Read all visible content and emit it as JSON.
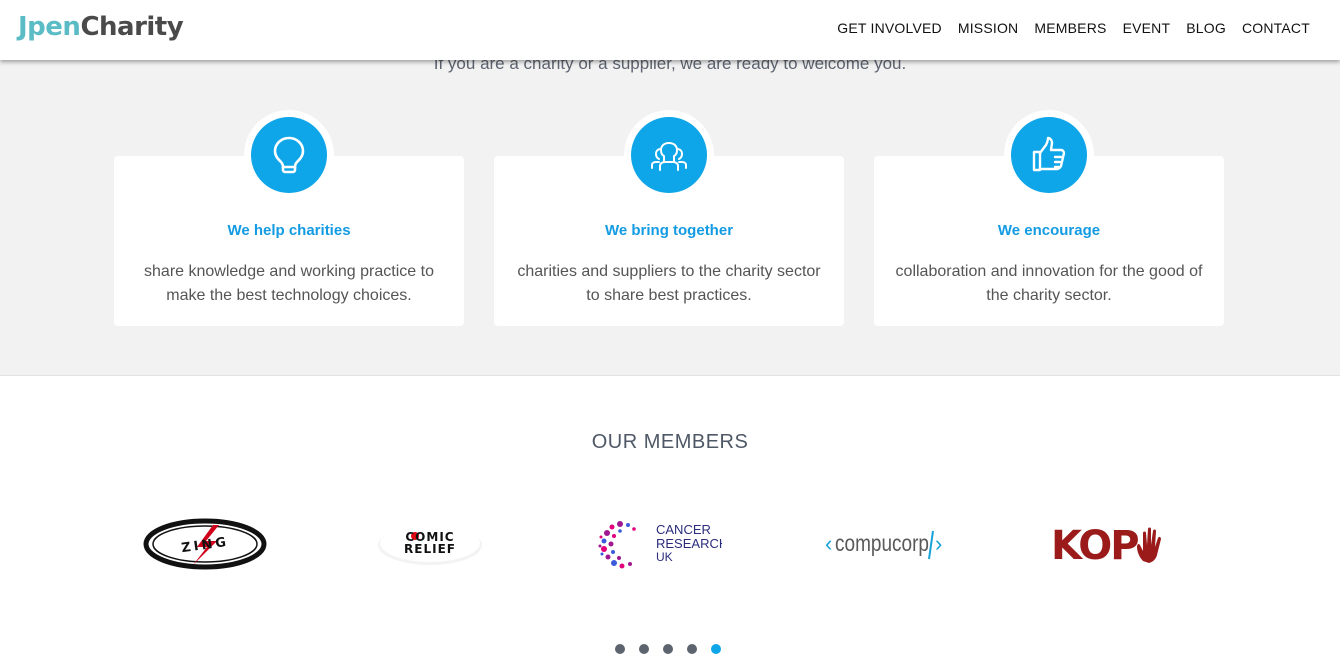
{
  "brand": {
    "logo_part1": "Jpen",
    "logo_part2": "Charity"
  },
  "nav": {
    "items": [
      "GET INVOLVED",
      "MISSION",
      "MEMBERS",
      "EVENT",
      "BLOG",
      "CONTACT"
    ]
  },
  "intro": {
    "text": "If you are a charity or a supplier, we are ready to welcome you."
  },
  "features": [
    {
      "icon": "lightbulb-icon",
      "title": "We help charities",
      "text": "share knowledge and working practice to make the best technology choices."
    },
    {
      "icon": "people-icon",
      "title": "We bring together",
      "text": "charities and suppliers to the charity sector to share best practices."
    },
    {
      "icon": "thumbs-up-icon",
      "title": "We encourage",
      "text": "collaboration and innovation for the good of the charity sector."
    }
  ],
  "members": {
    "title": "OUR MEMBERS",
    "logos": [
      {
        "name": "zing-logo",
        "text": "ZING"
      },
      {
        "name": "comic-relief-logo",
        "line1": "COMIC",
        "line2": "RELIEF"
      },
      {
        "name": "cancer-research-uk-logo",
        "line1": "CANCER",
        "line2": "RESEARCH",
        "line3": "UK"
      },
      {
        "name": "compucorp-logo",
        "text": "compucorp"
      },
      {
        "name": "kop-logo",
        "text": "KOP"
      }
    ]
  },
  "carousel": {
    "dot_count": 5,
    "active_index": 4
  },
  "colors": {
    "accent": "#0ea5e9",
    "title_blue": "#139be3",
    "band": "#f2f2f2",
    "logo_teal": "#5bbcc6"
  }
}
